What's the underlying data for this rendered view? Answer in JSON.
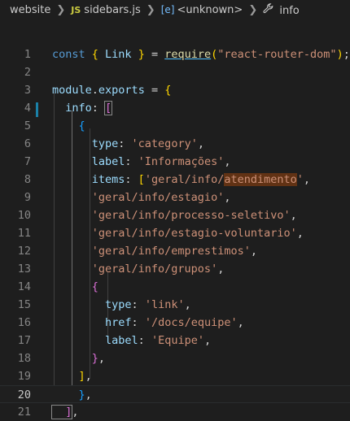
{
  "breadcrumb": {
    "folder": "website",
    "file_badge": "JS",
    "file": "sidebars.js",
    "symbol_icon": "[e]",
    "symbol": "<unknown>",
    "property": "info"
  },
  "lines": [
    {
      "n": "1",
      "tokens": [
        {
          "t": "const ",
          "c": "kw"
        },
        {
          "t": "{ ",
          "c": "b1"
        },
        {
          "t": "Link ",
          "c": "var"
        },
        {
          "t": "} ",
          "c": "b1"
        },
        {
          "t": "= ",
          "c": "p"
        },
        {
          "t": "require",
          "c": "fn"
        },
        {
          "t": "(",
          "c": "b1"
        },
        {
          "t": "\"react-router-dom\"",
          "c": "str"
        },
        {
          "t": ")",
          "c": "b1"
        },
        {
          "t": ";",
          "c": "p"
        }
      ]
    },
    {
      "n": "2",
      "tokens": []
    },
    {
      "n": "3",
      "tokens": [
        {
          "t": "module",
          "c": "var"
        },
        {
          "t": ".",
          "c": "p"
        },
        {
          "t": "exports ",
          "c": "var"
        },
        {
          "t": "= ",
          "c": "p"
        },
        {
          "t": "{",
          "c": "b1"
        }
      ]
    },
    {
      "n": "4",
      "tokens": [
        {
          "t": "  info",
          "c": "prop"
        },
        {
          "t": ": ",
          "c": "p"
        },
        {
          "t": "[",
          "c": "b2 bm"
        }
      ]
    },
    {
      "n": "5",
      "tokens": [
        {
          "t": "    {",
          "c": "b3"
        }
      ]
    },
    {
      "n": "6",
      "tokens": [
        {
          "t": "      type",
          "c": "prop"
        },
        {
          "t": ": ",
          "c": "p"
        },
        {
          "t": "'category'",
          "c": "str"
        },
        {
          "t": ",",
          "c": "p"
        }
      ]
    },
    {
      "n": "7",
      "tokens": [
        {
          "t": "      label",
          "c": "prop"
        },
        {
          "t": ": ",
          "c": "p"
        },
        {
          "t": "'Informações'",
          "c": "str"
        },
        {
          "t": ",",
          "c": "p"
        }
      ]
    },
    {
      "n": "8",
      "tokens": [
        {
          "t": "      items",
          "c": "prop"
        },
        {
          "t": ": ",
          "c": "p"
        },
        {
          "t": "[",
          "c": "b1"
        },
        {
          "t": "'geral/info/",
          "c": "str"
        },
        {
          "t": "atendimento",
          "c": "str hl"
        },
        {
          "t": "'",
          "c": "str"
        },
        {
          "t": ",",
          "c": "p"
        }
      ]
    },
    {
      "n": "9",
      "tokens": [
        {
          "t": "      'geral/info/estagio'",
          "c": "str"
        },
        {
          "t": ",",
          "c": "p"
        }
      ]
    },
    {
      "n": "10",
      "tokens": [
        {
          "t": "      'geral/info/processo-seletivo'",
          "c": "str"
        },
        {
          "t": ",",
          "c": "p"
        }
      ]
    },
    {
      "n": "11",
      "tokens": [
        {
          "t": "      'geral/info/estagio-voluntario'",
          "c": "str"
        },
        {
          "t": ",",
          "c": "p"
        }
      ]
    },
    {
      "n": "12",
      "tokens": [
        {
          "t": "      'geral/info/emprestimos'",
          "c": "str"
        },
        {
          "t": ",",
          "c": "p"
        }
      ]
    },
    {
      "n": "13",
      "tokens": [
        {
          "t": "      'geral/info/grupos'",
          "c": "str"
        },
        {
          "t": ",",
          "c": "p"
        }
      ]
    },
    {
      "n": "14",
      "tokens": [
        {
          "t": "      {",
          "c": "b2"
        }
      ]
    },
    {
      "n": "15",
      "tokens": [
        {
          "t": "        type",
          "c": "prop"
        },
        {
          "t": ": ",
          "c": "p"
        },
        {
          "t": "'link'",
          "c": "str"
        },
        {
          "t": ",",
          "c": "p"
        }
      ]
    },
    {
      "n": "16",
      "tokens": [
        {
          "t": "        href",
          "c": "prop"
        },
        {
          "t": ": ",
          "c": "p"
        },
        {
          "t": "'/docs/equipe'",
          "c": "str"
        },
        {
          "t": ",",
          "c": "p"
        }
      ]
    },
    {
      "n": "17",
      "tokens": [
        {
          "t": "        label",
          "c": "prop"
        },
        {
          "t": ": ",
          "c": "p"
        },
        {
          "t": "'Equipe'",
          "c": "str"
        },
        {
          "t": ",",
          "c": "p"
        }
      ]
    },
    {
      "n": "18",
      "tokens": [
        {
          "t": "      }",
          "c": "b2"
        },
        {
          "t": ",",
          "c": "p"
        }
      ]
    },
    {
      "n": "19",
      "tokens": [
        {
          "t": "    ]",
          "c": "b1"
        },
        {
          "t": ",",
          "c": "p"
        }
      ]
    },
    {
      "n": "20",
      "tokens": [
        {
          "t": "    }",
          "c": "b3"
        },
        {
          "t": ",",
          "c": "p"
        }
      ]
    },
    {
      "n": "21",
      "tokens": [
        {
          "t": "  ]",
          "c": "b2 bm"
        },
        {
          "t": ",",
          "c": "p"
        }
      ]
    }
  ],
  "current_line": "20",
  "modified_line": "4"
}
